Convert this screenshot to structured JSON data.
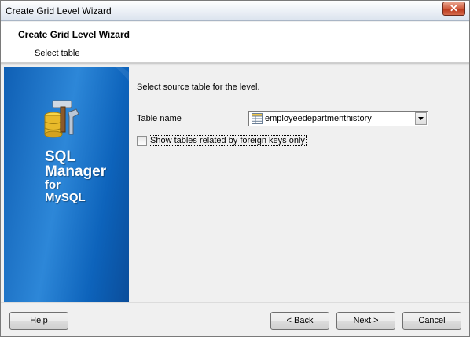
{
  "window": {
    "title": "Create Grid Level Wizard",
    "close_glyph": "✕"
  },
  "header": {
    "title": "Create Grid Level Wizard",
    "subtitle": "Select table"
  },
  "banner": {
    "line1": "SQL",
    "line2": "Manager",
    "line3": "for",
    "line4": "MySQL",
    "icon": "tools-database-icon"
  },
  "content": {
    "instruction": "Select source table for the level.",
    "table_name_label": "Table name",
    "table_name_value": "employeedepartmenthistory",
    "checkbox_label": "Show tables related by foreign keys only",
    "checkbox_checked": false
  },
  "footer": {
    "help": {
      "mnemonic": "H",
      "rest": "elp"
    },
    "back": {
      "prefix": "< ",
      "mnemonic": "B",
      "rest": "ack"
    },
    "next": {
      "mnemonic": "N",
      "rest": "ext >"
    },
    "cancel": "Cancel"
  }
}
